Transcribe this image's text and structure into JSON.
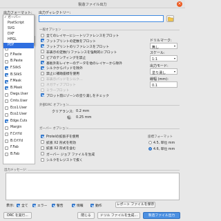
{
  "window": {
    "title": "製造ファイル出力"
  },
  "format": {
    "label": "出力フォーマット:",
    "selected": "ガーバー",
    "options": [
      "ガーバー",
      "PostScript",
      "SVG",
      "DXF",
      "HPGL",
      "PDF"
    ],
    "highlighted": "PDF"
  },
  "output_dir": {
    "label": "出力ディレクトリー:",
    "value": ""
  },
  "layers": [
    {
      "name": "F.Adhes",
      "checked": false
    },
    {
      "name": "B.Adhes",
      "checked": false
    },
    {
      "name": "F.Paste",
      "checked": false
    },
    {
      "name": "B.Paste",
      "checked": false
    },
    {
      "name": "F.SilkS",
      "checked": true
    },
    {
      "name": "B.SilkS",
      "checked": true
    },
    {
      "name": "F.Mask",
      "checked": true
    },
    {
      "name": "B.Mask",
      "checked": true
    },
    {
      "name": "Dwgs.User",
      "checked": false
    },
    {
      "name": "Cmts.User",
      "checked": false
    },
    {
      "name": "Eco1.User",
      "checked": false
    },
    {
      "name": "Eco2.User",
      "checked": false
    },
    {
      "name": "Edge.Cuts",
      "checked": true
    },
    {
      "name": "Margin",
      "checked": false
    },
    {
      "name": "F.CrtYd",
      "checked": false
    },
    {
      "name": "B.CrtYd",
      "checked": false
    },
    {
      "name": "F.Fab",
      "checked": false
    },
    {
      "name": "B.Fab",
      "checked": false
    }
  ],
  "general": {
    "title": "一般オプション",
    "options": [
      {
        "label": "全てのレイヤーにシートリファレンスをプロット",
        "checked": false,
        "disabled": false
      },
      {
        "label": "フットプリントの定数をプロット",
        "checked": true,
        "disabled": false
      },
      {
        "label": "フットプリントのリファレンスをプロット",
        "checked": true,
        "disabled": false
      },
      {
        "label": "非表示の定数/リファレンスを強制的にプロット",
        "checked": false,
        "disabled": false
      },
      {
        "label": "ビアのテンティングを禁止",
        "checked": false,
        "disabled": false
      },
      {
        "label": "基板外形レイヤーのデータを他のレイヤーから除外",
        "checked": true,
        "disabled": false
      },
      {
        "label": "シルクからパッドを除外",
        "checked": true,
        "disabled": false
      },
      {
        "label": "禁止に補助座標を使用",
        "checked": false,
        "disabled": false
      },
      {
        "label": "非表示パッドをシルク…",
        "checked": false,
        "disabled": true
      },
      {
        "label": "ネガティブプロット",
        "checked": false,
        "disabled": true
      },
      {
        "label": "ミラープロット",
        "checked": false,
        "disabled": true
      },
      {
        "label": "プロット前にゾーンの塗り潰しをチェック",
        "checked": true,
        "disabled": false
      }
    ],
    "drill_mark_label": "ドリルマーク:",
    "drill_mark_value": "無し",
    "scale_label": "スケール:",
    "scale_value": "1:1",
    "mode_label": "出力モード:",
    "mode_value": "塗り潰し",
    "width_label": "線幅 (mm):",
    "width_value": "0.1"
  },
  "drc": {
    "title": "外部DRC オプション",
    "clearance_label": "クリアランス:",
    "clearance_value": "0.2 mm",
    "min_label": "幅:",
    "min_value": "0.25 mm"
  },
  "gerber": {
    "title": "ガーバー オプション",
    "options": [
      {
        "label": "Protelの拡張子を使用",
        "checked": true,
        "disabled": false
      },
      {
        "label": "拡張 X2 形式を有効",
        "checked": false,
        "disabled": false
      },
      {
        "label": "拡張 X2 形式を含む",
        "checked": false,
        "disabled": false
      },
      {
        "label": "ガーバー ジョブ ファイルを生成",
        "checked": false,
        "disabled": false
      },
      {
        "label": "シルクをレジストで抜く",
        "checked": false,
        "disabled": false
      }
    ],
    "coord_title": "座標フォーマット",
    "coord_options": [
      {
        "label": "4.5, 単位 mm",
        "selected": false
      },
      {
        "label": "4.6, 単位 mm",
        "selected": true
      }
    ]
  },
  "messages": {
    "label": "出力メッセージ:"
  },
  "filters": {
    "label": "表示:",
    "items": [
      {
        "label": "全て",
        "checked": true
      },
      {
        "label": "エラー",
        "checked": true
      },
      {
        "label": "警告",
        "checked": true
      },
      {
        "label": "情報",
        "checked": true
      },
      {
        "label": "動作",
        "checked": true
      }
    ],
    "save_report": "レポート ファイルを保存"
  },
  "buttons": {
    "run_drc": "DRC を実行...",
    "close": "閉じる",
    "gen_drill": "ドリル ファイルを生成...",
    "plot": "製造ファイル出力"
  },
  "colors": {
    "accent": "#3f89e0",
    "highlight": "#2f6fe0",
    "close": "#ed5b22"
  }
}
